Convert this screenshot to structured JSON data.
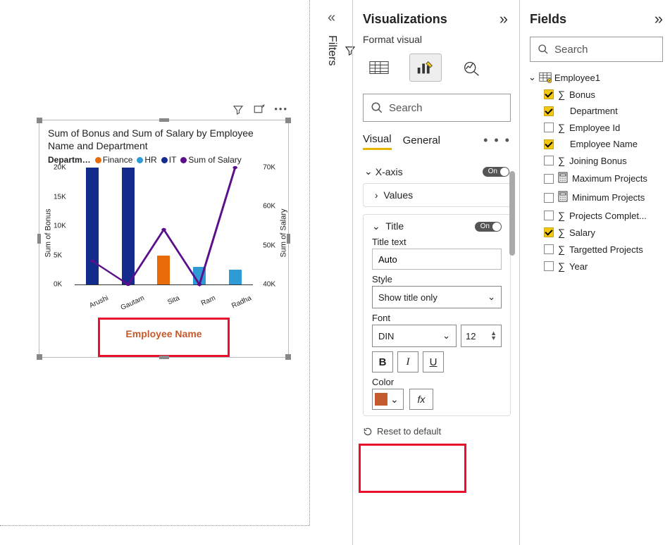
{
  "viz_pane": {
    "title": "Visualizations",
    "subtitle": "Format visual",
    "search_placeholder": "Search",
    "tabs": {
      "visual": "Visual",
      "general": "General"
    },
    "groups": {
      "xaxis": {
        "label": "X-axis",
        "toggle": "On"
      },
      "values": {
        "label": "Values"
      },
      "title": {
        "label": "Title",
        "toggle": "On"
      }
    },
    "title_section": {
      "title_text_label": "Title text",
      "title_text_value": "Auto",
      "style_label": "Style",
      "style_value": "Show title only",
      "font_label": "Font",
      "font_family": "DIN",
      "font_size": "12",
      "bold": "B",
      "italic": "I",
      "underline": "U",
      "color_label": "Color",
      "fx": "fx"
    },
    "reset": "Reset to default"
  },
  "fields_pane": {
    "title": "Fields",
    "search_placeholder": "Search",
    "table": "Employee1",
    "items": [
      {
        "checked": true,
        "icon": "sigma",
        "label": "Bonus"
      },
      {
        "checked": true,
        "icon": "",
        "label": "Department"
      },
      {
        "checked": false,
        "icon": "sigma",
        "label": "Employee Id"
      },
      {
        "checked": true,
        "icon": "",
        "label": "Employee Name"
      },
      {
        "checked": false,
        "icon": "sigma",
        "label": "Joining Bonus"
      },
      {
        "checked": false,
        "icon": "calc",
        "label": "Maximum Projects"
      },
      {
        "checked": false,
        "icon": "calc",
        "label": "Minimum Projects"
      },
      {
        "checked": false,
        "icon": "sigma",
        "label": "Projects Complet..."
      },
      {
        "checked": true,
        "icon": "sigma",
        "label": "Salary"
      },
      {
        "checked": false,
        "icon": "sigma",
        "label": "Targetted Projects"
      },
      {
        "checked": false,
        "icon": "sigma",
        "label": "Year"
      }
    ]
  },
  "filters_label": "Filters",
  "chart": {
    "title": "Sum of Bonus and Sum of Salary by Employee Name and Department",
    "legend_label": "Departm…",
    "y_left_label": "Sum of Bonus",
    "y_right_label": "Sum of Salary",
    "x_title": "Employee Name",
    "y_left_ticks": [
      "20K",
      "15K",
      "10K",
      "5K",
      "0K"
    ],
    "y_right_ticks": [
      "70K",
      "60K",
      "50K",
      "40K"
    ]
  },
  "chart_data": {
    "type": "bar",
    "title": "Sum of Bonus and Sum of Salary by Employee Name and Department",
    "xlabel": "Employee Name",
    "ylabel": "Sum of Bonus",
    "ylabel_right": "Sum of Salary",
    "ylim_left": [
      0,
      20
    ],
    "ylim_right": [
      40,
      70
    ],
    "categories": [
      "Arushi",
      "Gautam",
      "Sita",
      "Ram",
      "Radha"
    ],
    "series": [
      {
        "name": "Finance",
        "color": "#E86C0A",
        "values": [
          null,
          null,
          5,
          null,
          null
        ]
      },
      {
        "name": "HR",
        "color": "#2E9BD6",
        "values": [
          null,
          null,
          null,
          3,
          2.5
        ]
      },
      {
        "name": "IT",
        "color": "#132B8C",
        "values": [
          20,
          20,
          null,
          null,
          null
        ]
      }
    ],
    "line_series": {
      "name": "Sum of Salary",
      "color": "#5B0F8B",
      "values": [
        46,
        40,
        54,
        40,
        70
      ]
    }
  }
}
